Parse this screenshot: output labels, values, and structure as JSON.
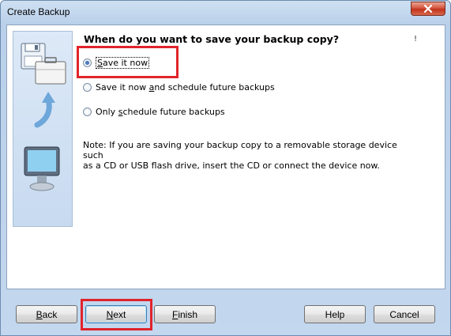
{
  "window": {
    "title": "Create Backup"
  },
  "heading": "When do you want to save your backup copy?",
  "corner_mark": "!",
  "options": [
    {
      "pre": "",
      "key": "S",
      "post": "ave it now",
      "checked": true
    },
    {
      "pre": "Save it now ",
      "key": "a",
      "post": "nd schedule future backups",
      "checked": false
    },
    {
      "pre": "Only ",
      "key": "s",
      "post": "chedule future backups",
      "checked": false
    }
  ],
  "note_line1": "Note: If you are saving your backup copy to a removable storage device such",
  "note_line2": "as a CD or USB flash drive, insert the CD or connect the device now.",
  "buttons": {
    "back": {
      "pre": "",
      "key": "B",
      "post": "ack"
    },
    "next": {
      "pre": "",
      "key": "N",
      "post": "ext"
    },
    "finish": {
      "pre": "",
      "key": "F",
      "post": "inish"
    },
    "help": {
      "label": "Help"
    },
    "cancel": {
      "label": "Cancel"
    }
  },
  "icons": {
    "close": "close-icon",
    "floppy": "floppy-disk-icon",
    "briefcase": "briefcase-icon",
    "arrow": "curved-arrow-icon",
    "monitor": "monitor-icon"
  },
  "colors": {
    "highlight": "#e0242b",
    "accent": "#3c7fb1"
  }
}
